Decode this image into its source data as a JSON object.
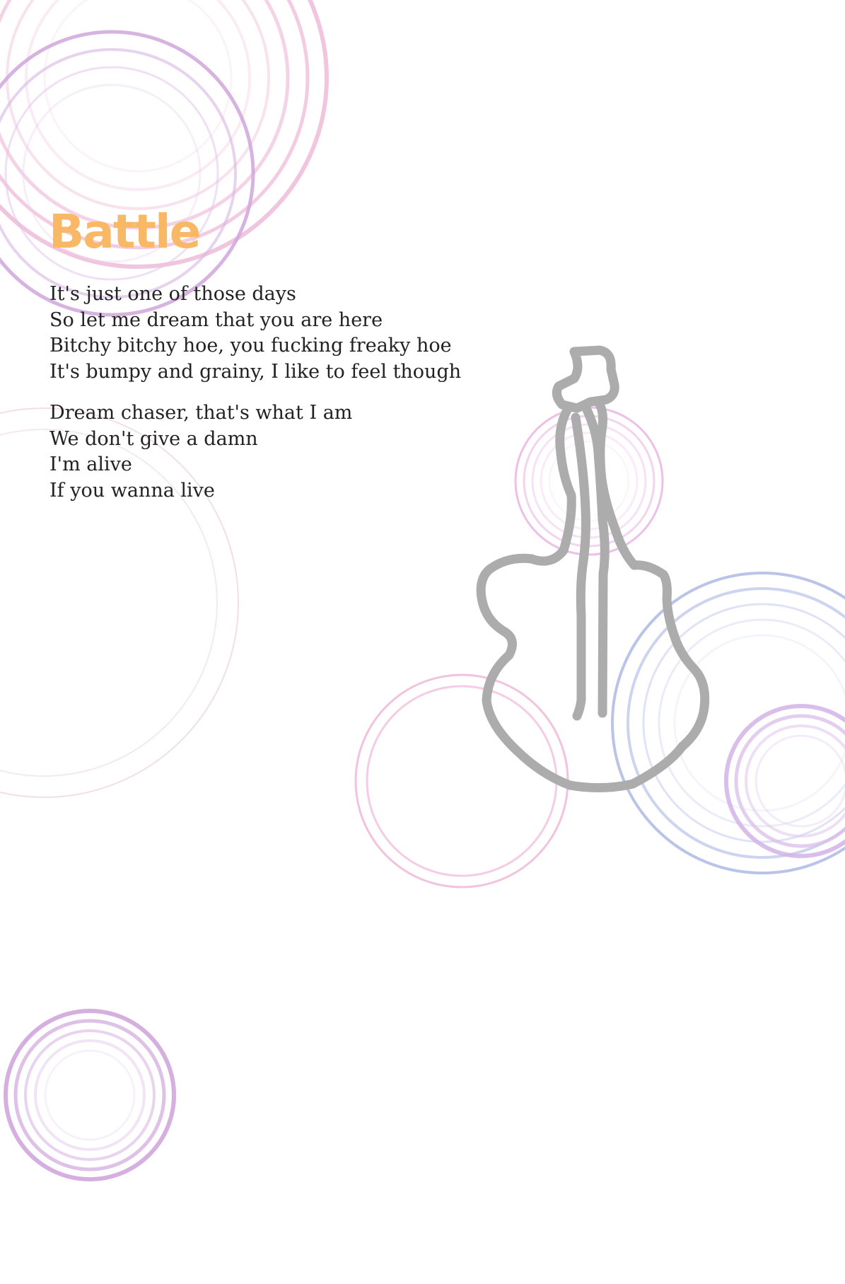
{
  "song": {
    "title": "Battle",
    "stanzas": [
      {
        "lines": [
          "It's just one of those days",
          "So let me dream that you are here",
          "Bitchy bitchy hoe, you fucking freaky hoe",
          "It's bumpy and grainy, I like to feel though"
        ]
      },
      {
        "lines": [
          "Dream chaser, that's what I am",
          "We don't give a damn",
          "I'm alive",
          "If you wanna live"
        ]
      }
    ]
  },
  "colors": {
    "title": "#f9b866",
    "text": "#222222",
    "circle_pink": "#eeb6d6",
    "circle_purple": "#cfa6dc",
    "circle_blue": "#b3bde6",
    "guitar": "#acacac"
  },
  "illustration": {
    "guitar": "guitar-outline-drawing",
    "rings": "concentric-circle-rings"
  }
}
